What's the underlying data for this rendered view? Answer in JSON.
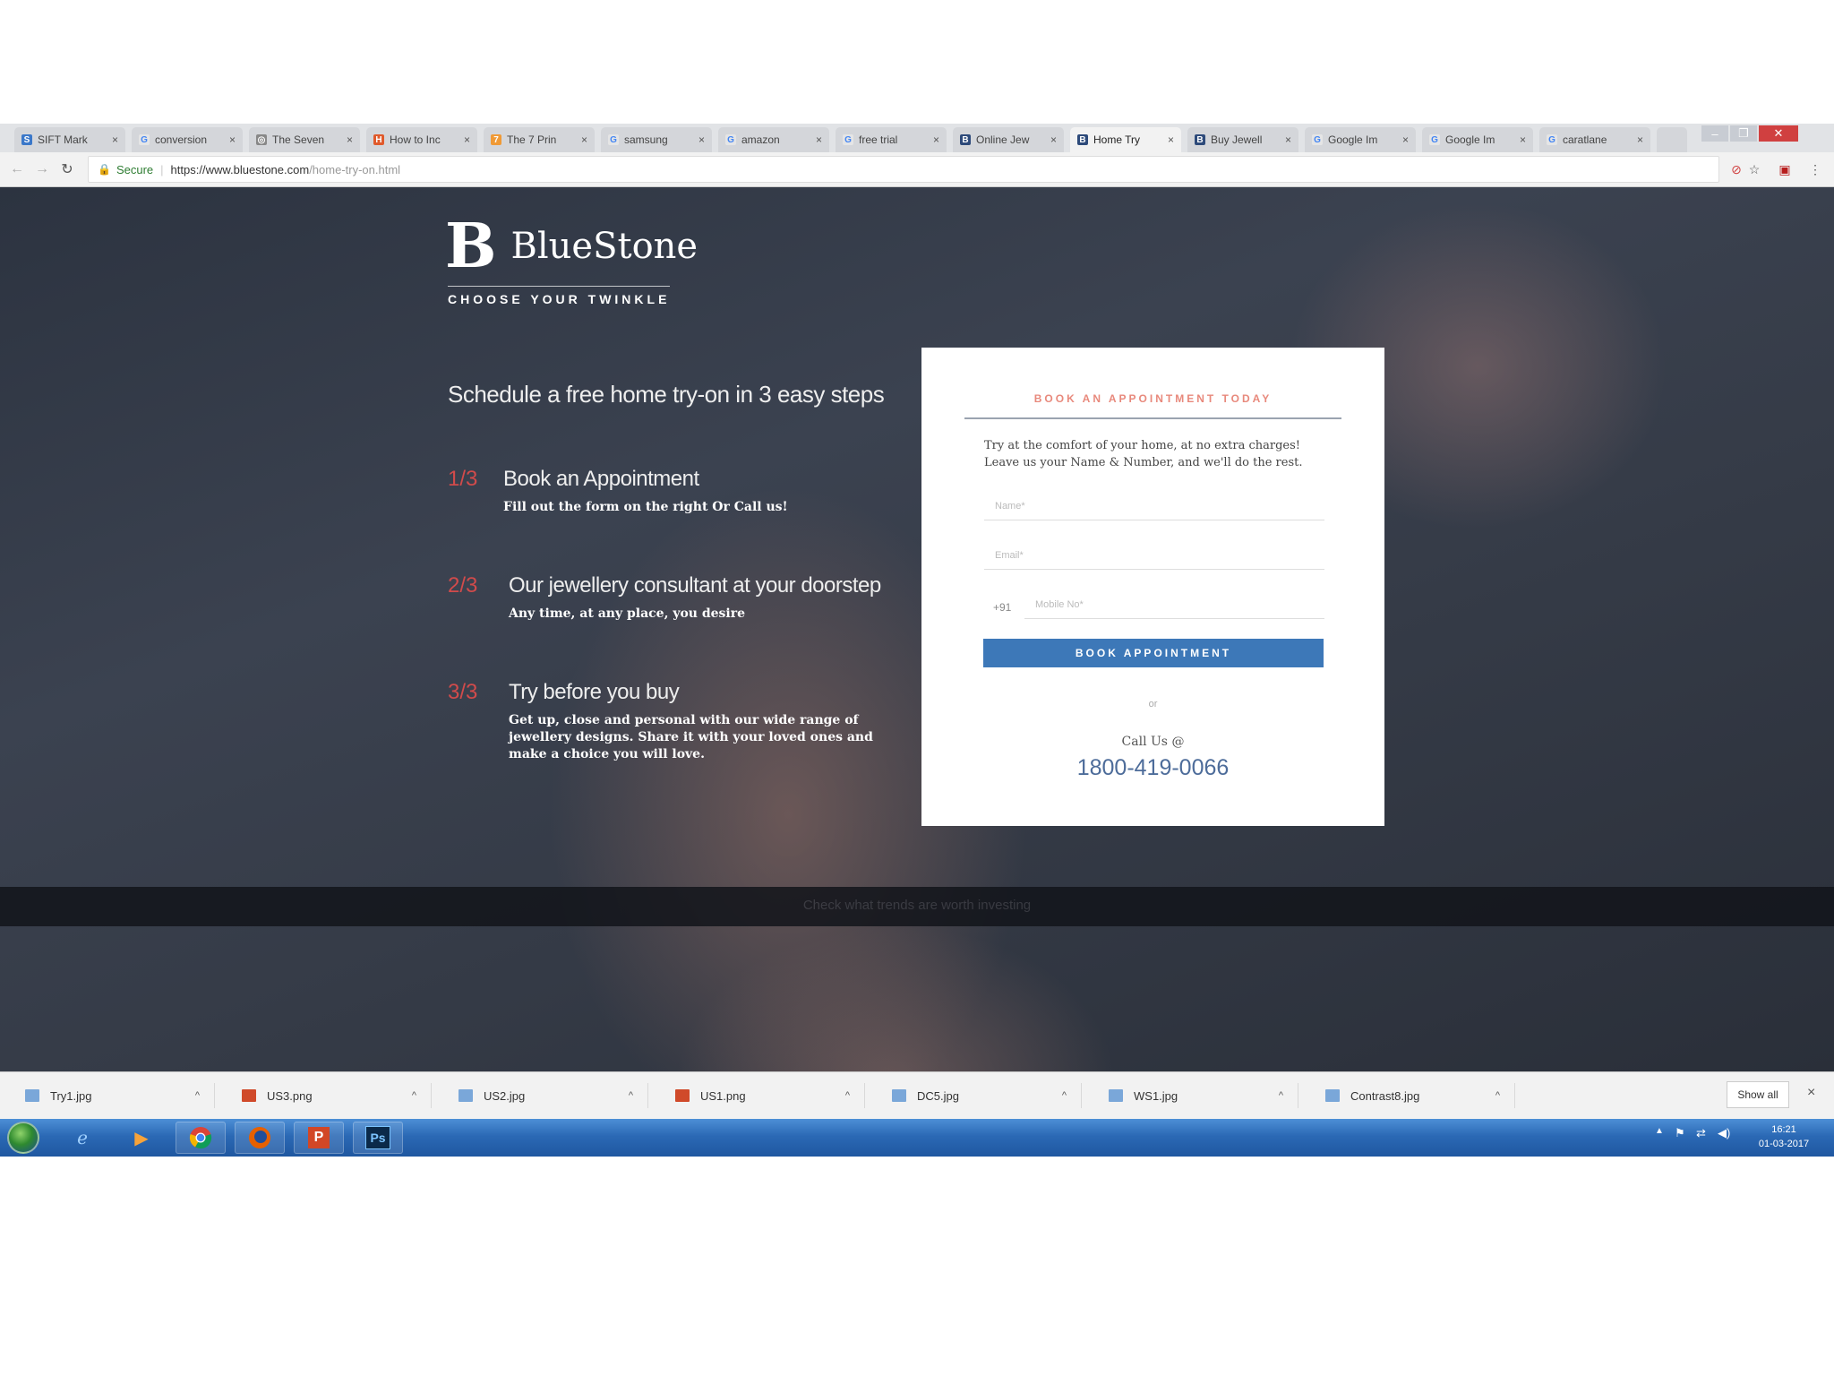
{
  "browser": {
    "tabs": [
      {
        "label": "SIFT Mark",
        "icon_color": "#3b78c9",
        "icon_char": "S"
      },
      {
        "label": "conversion",
        "icon_color": "#e5e5e5",
        "icon_char": "G"
      },
      {
        "label": "The Seven",
        "icon_color": "#888888",
        "icon_char": "◎"
      },
      {
        "label": "How to Inc",
        "icon_color": "#e05a2b",
        "icon_char": "H"
      },
      {
        "label": "The 7 Prin",
        "icon_color": "#f09a36",
        "icon_char": "7"
      },
      {
        "label": "samsung",
        "icon_color": "#e5e5e5",
        "icon_char": "G"
      },
      {
        "label": "amazon",
        "icon_color": "#e5e5e5",
        "icon_char": "G"
      },
      {
        "label": "free trial",
        "icon_color": "#e5e5e5",
        "icon_char": "G"
      },
      {
        "label": "Online Jew",
        "icon_color": "#2d4a7a",
        "icon_char": "B"
      },
      {
        "label": "Home Try",
        "icon_color": "#2d4a7a",
        "icon_char": "B",
        "active": true
      },
      {
        "label": "Buy Jewell",
        "icon_color": "#2d4a7a",
        "icon_char": "B"
      },
      {
        "label": "Google Im",
        "icon_color": "#e5e5e5",
        "icon_char": "G"
      },
      {
        "label": "Google Im",
        "icon_color": "#e5e5e5",
        "icon_char": "G"
      },
      {
        "label": "caratlane",
        "icon_color": "#e5e5e5",
        "icon_char": "G"
      }
    ],
    "tab_close": "×",
    "address": {
      "secure_label": "Secure",
      "url_host": "https://www.bluestone.com",
      "url_path": "/home-try-on.html"
    }
  },
  "page": {
    "logo_mark": "B",
    "logo_text": "BlueStone",
    "tagline": "CHOOSE YOUR TWINKLE",
    "headline": "Schedule a free home try-on in 3 easy steps",
    "steps": [
      {
        "num": "1/3",
        "title": "Book an Appointment",
        "desc": "Fill out the form on the right Or Call us!"
      },
      {
        "num": "2/3",
        "title": "Our jewellery consultant at your doorstep",
        "desc": "Any time, at any place, you desire"
      },
      {
        "num": "3/3",
        "title": "Try before you buy",
        "desc": "Get up, close and personal with our wide range of jewellery designs. Share it with your loved ones and make a choice you will love."
      }
    ],
    "banner_text": "Check what trends are worth investing"
  },
  "form": {
    "title": "BOOK AN APPOINTMENT TODAY",
    "intro": "Try at the comfort of your home, at no extra charges! Leave us your Name & Number, and we'll do the rest.",
    "name_placeholder": "Name*",
    "email_placeholder": "Email*",
    "phone_prefix": "+91",
    "mobile_placeholder": "Mobile No*",
    "button_label": "BOOK APPOINTMENT",
    "or_label": "or",
    "call_label": "Call Us @",
    "phone": "1800-419-0066",
    "button_color": "#3d78b8",
    "title_color": "#e8897c"
  },
  "downloads": {
    "items": [
      {
        "name": "Try1.jpg",
        "icon_color": "#7aa7d9"
      },
      {
        "name": "US3.png",
        "icon_color": "#d04a2a"
      },
      {
        "name": "US2.jpg",
        "icon_color": "#7aa7d9"
      },
      {
        "name": "US1.png",
        "icon_color": "#d04a2a"
      },
      {
        "name": "DC5.jpg",
        "icon_color": "#7aa7d9"
      },
      {
        "name": "WS1.jpg",
        "icon_color": "#7aa7d9"
      },
      {
        "name": "Contrast8.jpg",
        "icon_color": "#7aa7d9"
      }
    ],
    "show_all": "Show all",
    "close": "×"
  },
  "taskbar": {
    "clock_time": "16:21",
    "clock_date": "01-03-2017",
    "apps": [
      "ie-icon",
      "media-player-icon",
      "chrome-icon",
      "firefox-icon",
      "powerpoint-icon",
      "photoshop-icon"
    ],
    "photoshop_label": "Ps",
    "powerpoint_label": "P"
  }
}
